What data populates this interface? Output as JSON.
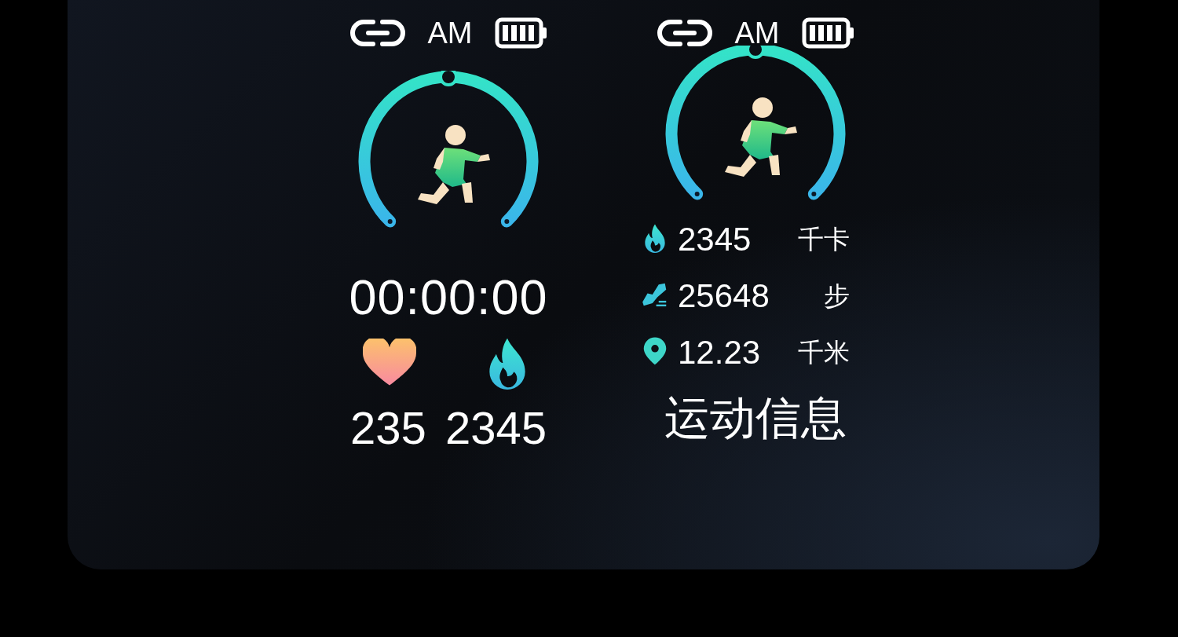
{
  "screens": [
    {
      "kind": "workout",
      "status": {
        "time_label": "AM"
      },
      "timer": "00:00:00",
      "metrics": [
        {
          "kind": "heart",
          "value": "235"
        },
        {
          "kind": "flame",
          "value": "2345"
        }
      ]
    },
    {
      "kind": "info",
      "status": {
        "time_label": "AM"
      },
      "stats": [
        {
          "kind": "flame",
          "value": "2345",
          "unit": "千卡"
        },
        {
          "kind": "shoe",
          "value": "25648",
          "unit": "步"
        },
        {
          "kind": "pin",
          "value": "12.23",
          "unit": "千米"
        }
      ],
      "title": "运动信息"
    }
  ]
}
